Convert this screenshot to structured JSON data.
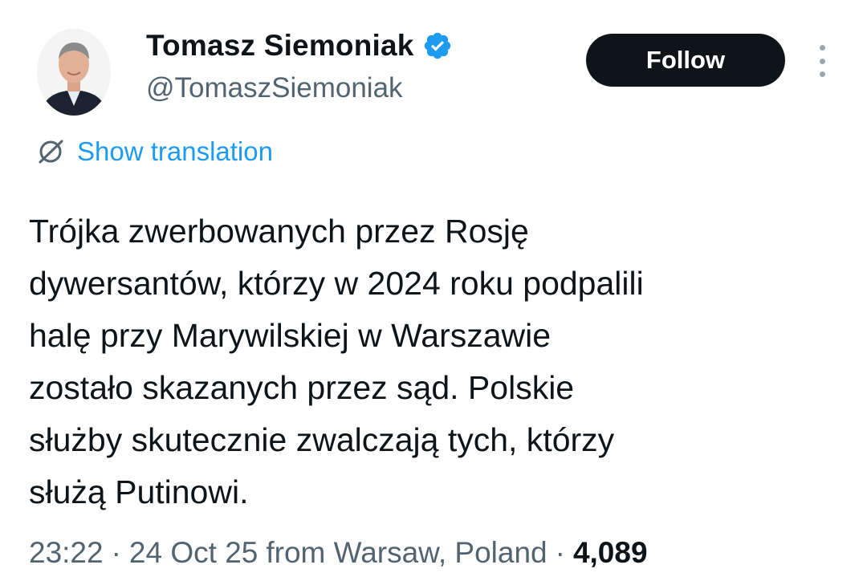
{
  "author": {
    "display_name": "Tomasz Siemoniak",
    "handle": "@TomaszSiemoniak",
    "verified": true,
    "verified_badge_color": "#1d9bf0"
  },
  "actions": {
    "follow_label": "Follow",
    "more_icon": "more-vertical-icon"
  },
  "translation": {
    "label": "Show translation",
    "icon": "globe-slash-icon"
  },
  "tweet": {
    "lines": [
      "Trójka zwerbowanych przez Rosję",
      "dywersantów, którzy w 2024 roku podpalili",
      "halę przy Marywilskiej w Warszawie",
      "zostało skazanych przez sąd. Polskie",
      "służby skutecznie zwalczają tych, którzy",
      "służą Putinowi."
    ]
  },
  "meta": {
    "time": "23:22",
    "date": "24 Oct 25",
    "location": "from Warsaw, Poland",
    "views": "4,089",
    "separator": "·"
  },
  "colors": {
    "text_primary": "#0f1419",
    "text_secondary": "#536471",
    "link": "#1d9bf0",
    "button_bg": "#0f1419",
    "button_text": "#ffffff"
  }
}
